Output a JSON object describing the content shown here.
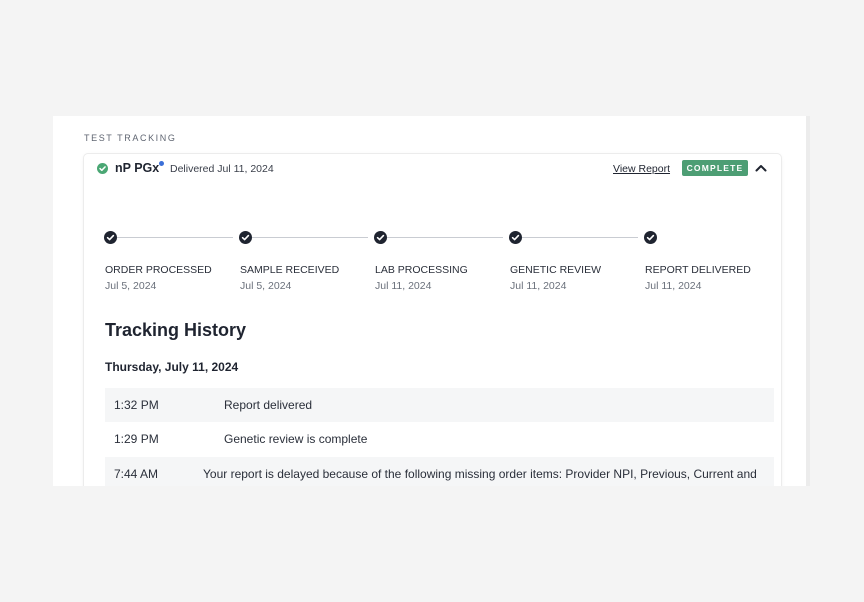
{
  "section_label": "TEST TRACKING",
  "test": {
    "name": "nP PGx",
    "delivered": "Delivered Jul 11, 2024",
    "view_report_label": "View Report",
    "status": "COMPLETE",
    "status_color": "#4d9e74",
    "collapse_icon": "chevron-up-icon"
  },
  "steps": [
    {
      "label": "ORDER PROCESSED",
      "date": "Jul 5, 2024",
      "completed": true
    },
    {
      "label": "SAMPLE RECEIVED",
      "date": "Jul 5, 2024",
      "completed": true
    },
    {
      "label": "LAB PROCESSING",
      "date": "Jul 11, 2024",
      "completed": true
    },
    {
      "label": "GENETIC REVIEW",
      "date": "Jul 11, 2024",
      "completed": true
    },
    {
      "label": "REPORT DELIVERED",
      "date": "Jul 11, 2024",
      "completed": true
    }
  ],
  "history": {
    "title": "Tracking History",
    "date": "Thursday, July 11, 2024",
    "events": [
      {
        "time": "1:32 PM",
        "text": "Report delivered"
      },
      {
        "time": "1:29 PM",
        "text": "Genetic review is complete"
      },
      {
        "time": "7:44 AM",
        "text": "Your report is delayed because of the following missing order items: Provider NPI, Previous, Current and"
      }
    ]
  },
  "colors": {
    "accent_green": "#4aa774",
    "dot_blue": "#3b6fd8",
    "step_dark": "#1f2430"
  }
}
